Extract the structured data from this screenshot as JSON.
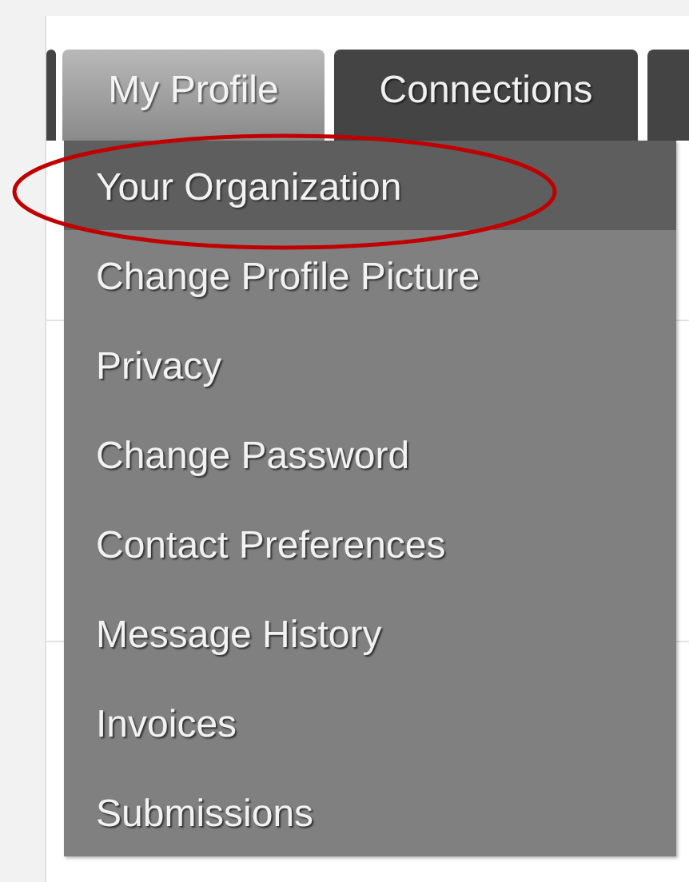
{
  "tabs": [
    {
      "label": "My Profile",
      "selected": true
    },
    {
      "label": "Connections",
      "selected": false
    }
  ],
  "menu": {
    "items": [
      {
        "label": "Your Organization",
        "highlighted": true
      },
      {
        "label": "Change Profile Picture",
        "highlighted": false
      },
      {
        "label": "Privacy",
        "highlighted": false
      },
      {
        "label": "Change Password",
        "highlighted": false
      },
      {
        "label": "Contact Preferences",
        "highlighted": false
      },
      {
        "label": "Message History",
        "highlighted": false
      },
      {
        "label": "Invoices",
        "highlighted": false
      },
      {
        "label": "Submissions",
        "highlighted": false
      }
    ]
  },
  "annotation": {
    "kind": "ellipse"
  }
}
